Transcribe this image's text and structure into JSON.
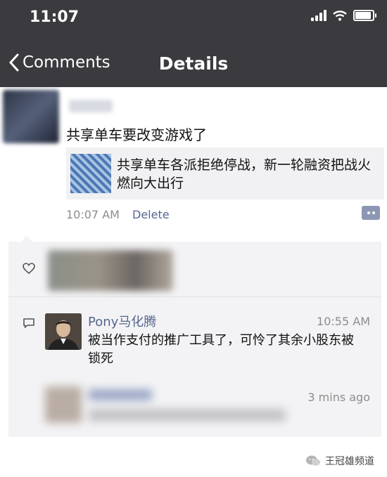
{
  "status_bar": {
    "time": "11:07",
    "signal_bars": 4,
    "wifi": "wifi-icon",
    "battery_level": 0.85
  },
  "nav": {
    "back_label": "Comments",
    "title": "Details"
  },
  "post": {
    "text": "共享单车要改变游戏了",
    "link_title": "共享单车各派拒绝停战，新一轮融资把战火燃向大出行",
    "time": "10:07 AM",
    "delete_label": "Delete"
  },
  "comments": [
    {
      "name": "Pony马化腾",
      "time": "10:55 AM",
      "text": "被当作支付的推广工具了，可怜了其余小股东被锁死"
    },
    {
      "time": "3 mins ago"
    }
  ],
  "watermark": "王冠雄频道",
  "colors": {
    "header_bg": "#3a3a3f",
    "link_blue": "#56668f",
    "panel_bg": "#f3f3f5",
    "wechat_green": "#2aae67"
  }
}
